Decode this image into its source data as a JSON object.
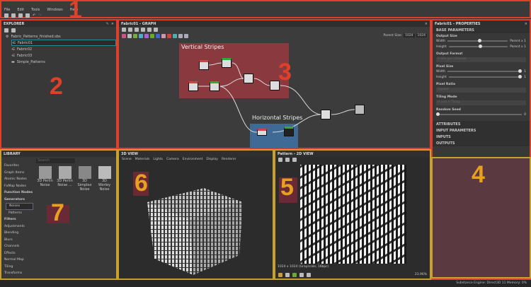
{
  "menu": [
    "File",
    "Edit",
    "Tools",
    "Windows",
    "Help"
  ],
  "annotations": [
    "1",
    "2",
    "3",
    "4",
    "5",
    "6",
    "7"
  ],
  "explorer": {
    "title": "EXPLORER",
    "package": "Fabric_Patterns_finished.sbs",
    "items": [
      "Fabric01",
      "Fabric02",
      "Fabric03",
      "Simple_Patterns"
    ]
  },
  "graph": {
    "title": "Fabric01 - GRAPH",
    "parent_size_label": "Parent Size:",
    "size_w": "1024",
    "size_h": "1024",
    "frames": [
      "Vertical Stripes",
      "Horizontal Stripes"
    ]
  },
  "properties": {
    "title": "Fabric01 - PROPERTIES",
    "base": "BASE PARAMETERS",
    "output_size": "Output Size",
    "width": "Width",
    "height": "Height",
    "parent_x1": "Parent x 1",
    "output_format": "Output Format",
    "output_format_value": "8 bits per channel",
    "pixel_size": "Pixel Size",
    "pixel_ratio": "Pixel Ratio",
    "pixel_ratio_value": "Square",
    "tiling_mode": "Tiling Mode",
    "tiling_value": "H and V Tiling",
    "random_seed": "Random Seed",
    "zero": "0",
    "one": "1",
    "attributes": "ATTRIBUTES",
    "input_params": "INPUT PARAMETERS",
    "inputs": "INPUTS",
    "outputs": "OUTPUTS"
  },
  "library": {
    "title": "LIBRARY",
    "search_placeholder": "Search",
    "categories": [
      "Favorites",
      "Graph Items",
      "Atomic Nodes",
      "FxMap Nodes",
      "Function Nodes",
      "Generators",
      "Noises",
      "Patterns",
      "Filters",
      "Adjustments",
      "Blending",
      "Blurs",
      "Channels",
      "Effects",
      "Normal Map",
      "Tiling",
      "Transforms"
    ],
    "thumbs": [
      "3D Perlin Noise",
      "3D Perlin Noise ...",
      "3D Simplex Noise",
      "3D Worley Noise"
    ]
  },
  "view3d": {
    "title": "3D VIEW",
    "menu": [
      "Scene",
      "Materials",
      "Lights",
      "Camera",
      "Environment",
      "Display",
      "Renderer"
    ]
  },
  "view2d": {
    "title": "Pattern - 2D VIEW",
    "resolution": "1024 x 1024 (Grayscale, 16bpc)",
    "zoom": "23.96%"
  },
  "status": "Substance Engine: Direct3D 11  Memory: 0%"
}
